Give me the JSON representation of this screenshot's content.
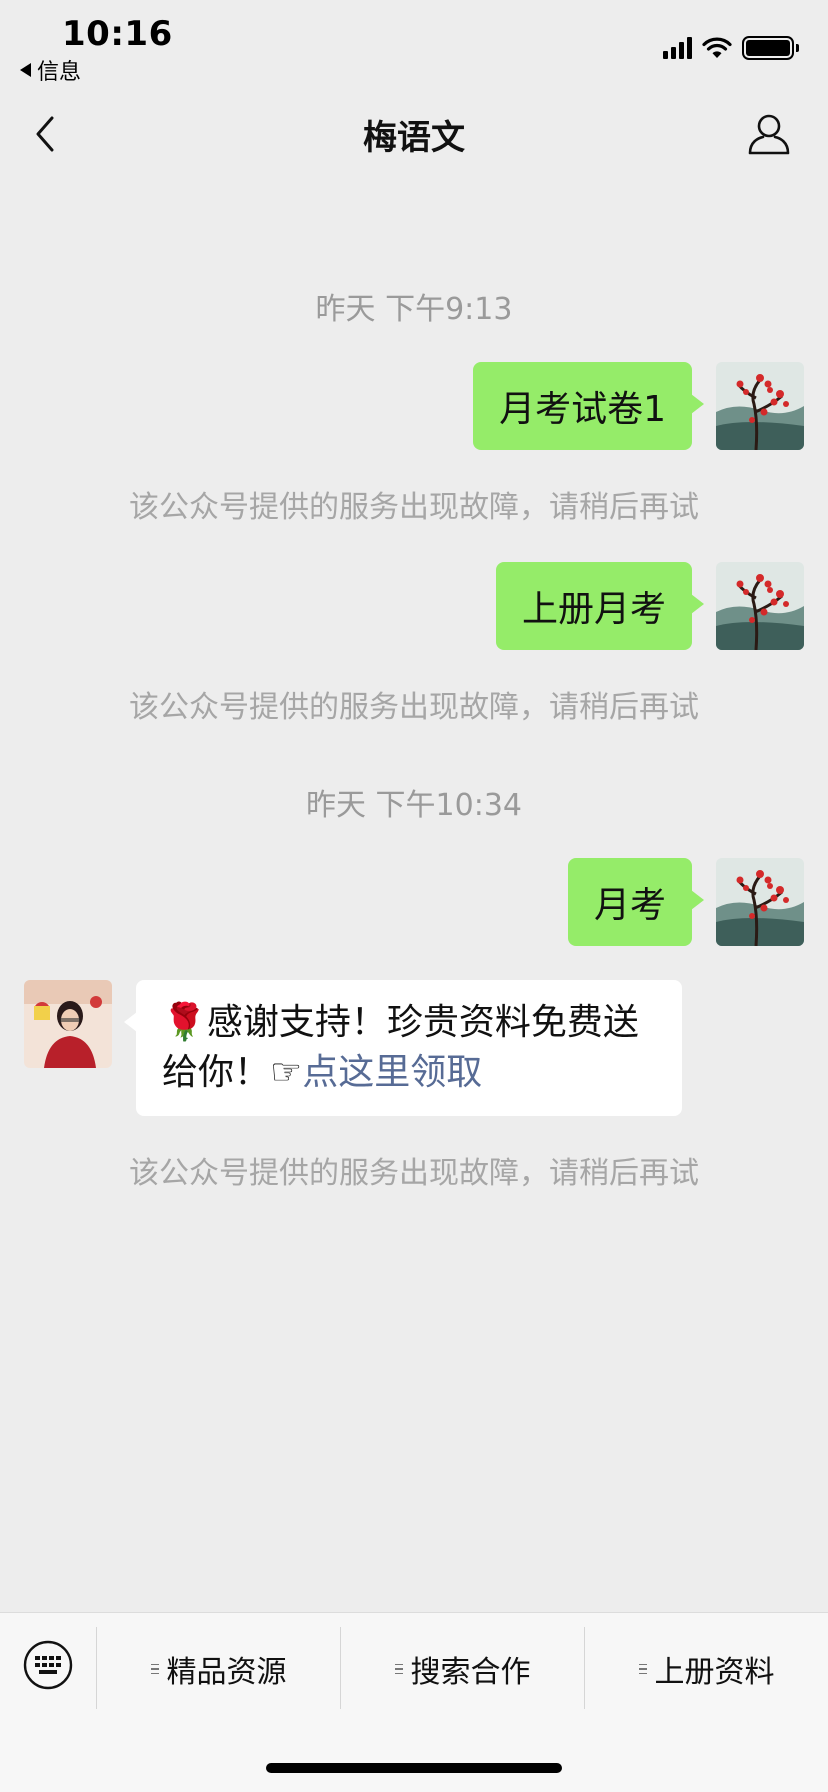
{
  "status_bar": {
    "time": "10:16",
    "back_app": "信息"
  },
  "nav": {
    "title": "梅语文"
  },
  "chat": {
    "messages": [
      {
        "type": "timestamp",
        "text": "昨天 下午9:13"
      },
      {
        "type": "outgoing",
        "text": "月考试卷1"
      },
      {
        "type": "system",
        "text": "该公众号提供的服务出现故障，请稍后再试"
      },
      {
        "type": "outgoing",
        "text": "上册月考"
      },
      {
        "type": "system",
        "text": "该公众号提供的服务出现故障，请稍后再试"
      },
      {
        "type": "timestamp",
        "text": "昨天 下午10:34"
      },
      {
        "type": "outgoing",
        "text": "月考"
      },
      {
        "type": "incoming",
        "emoji": "🌹",
        "text": "感谢支持！珍贵资料免费送给你！",
        "pointer": "☞",
        "link_text": "点这里领取"
      },
      {
        "type": "system",
        "text": "该公众号提供的服务出现故障，请稍后再试"
      }
    ]
  },
  "menu": {
    "items": [
      {
        "label": "精品资源"
      },
      {
        "label": "搜索合作"
      },
      {
        "label": "上册资料"
      }
    ]
  },
  "colors": {
    "outgoing_bubble": "#95ec69",
    "link": "#576b95",
    "background": "#ededed"
  }
}
